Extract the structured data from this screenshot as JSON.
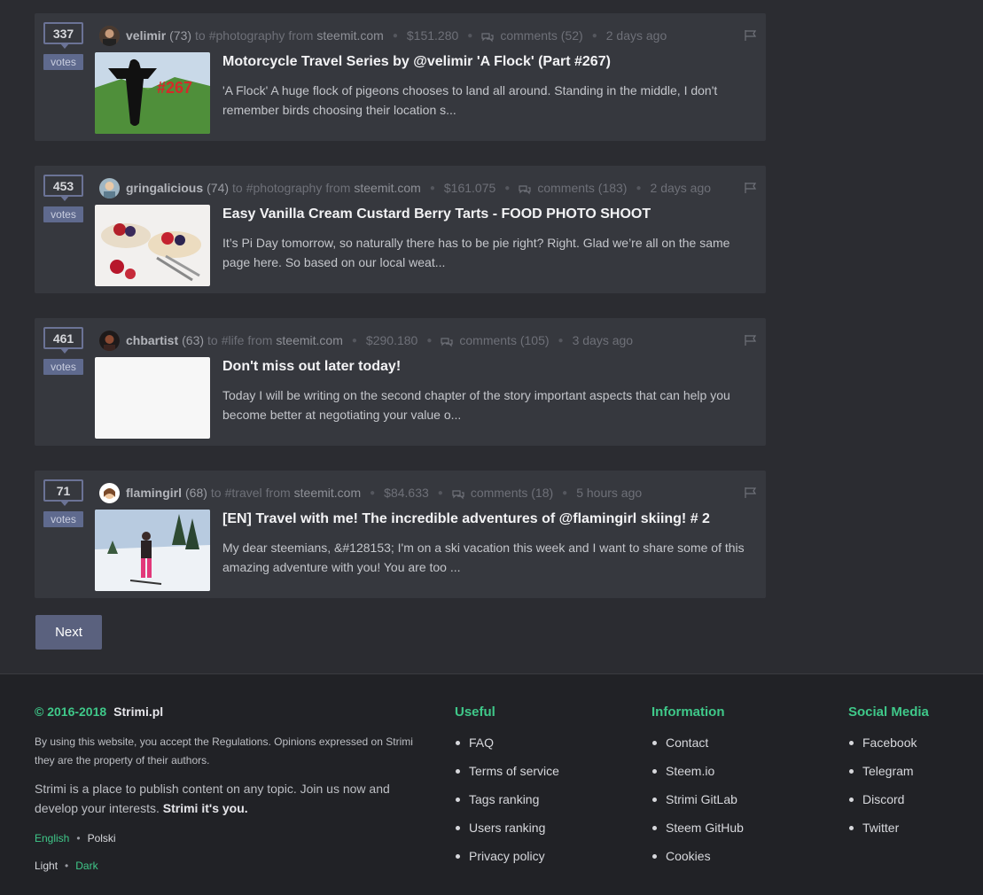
{
  "posts": [
    {
      "votes": "337",
      "votes_label": "votes",
      "author": "velimir",
      "rep": "(73)",
      "to": "to",
      "tag": "#photography",
      "from": "from",
      "site": "steemit.com",
      "payout": "$151.280",
      "comments": "comments (52)",
      "time": "2 days ago",
      "title": "Motorcycle Travel Series by @velimir 'A Flock' (Part #267)",
      "excerpt": "'A Flock' A huge flock of pigeons chooses to land all around. Standing in the middle, I don't remember birds choosing their location s...",
      "thumb_text": "#267"
    },
    {
      "votes": "453",
      "votes_label": "votes",
      "author": "gringalicious",
      "rep": "(74)",
      "to": "to",
      "tag": "#photography",
      "from": "from",
      "site": "steemit.com",
      "payout": "$161.075",
      "comments": "comments (183)",
      "time": "2 days ago",
      "title": "Easy Vanilla Cream Custard Berry Tarts - FOOD PHOTO SHOOT",
      "excerpt": "It’s Pi Day tomorrow, so naturally there has to be pie right? Right. Glad we’re all on the same page here. So based on our local weat..."
    },
    {
      "votes": "461",
      "votes_label": "votes",
      "author": "chbartist",
      "rep": "(63)",
      "to": "to",
      "tag": "#life",
      "from": "from",
      "site": "steemit.com",
      "payout": "$290.180",
      "comments": "comments (105)",
      "time": "3 days ago",
      "title": "Don't miss out later today!",
      "excerpt": "Today I will be writing on the second chapter of the story important aspects that can help you become better at negotiating your value o..."
    },
    {
      "votes": "71",
      "votes_label": "votes",
      "author": "flamingirl",
      "rep": "(68)",
      "to": "to",
      "tag": "#travel",
      "from": "from",
      "site": "steemit.com",
      "payout": "$84.633",
      "comments": "comments (18)",
      "time": "5 hours ago",
      "title": "[EN] Travel with me! The incredible adventures of @flamingirl skiing! # 2",
      "excerpt": "My dear steemians, &#128153; I'm on a ski vacation this week and I want to share some of this amazing adventure with you! You are too ..."
    }
  ],
  "pagination": {
    "next_label": "Next"
  },
  "footer": {
    "copyright": "© 2016-2018",
    "brand": "Strimi.pl",
    "regulations": "By using this website, you accept the Regulations. Opinions expressed on Strimi they are the property of their authors.",
    "about_text": "Strimi is a place to publish content on any topic. Join us now and develop your interests.",
    "about_bold": "Strimi it's you.",
    "lang_en": "English",
    "lang_pl": "Polski",
    "theme_light": "Light",
    "theme_dark": "Dark",
    "useful": {
      "heading": "Useful",
      "items": [
        "FAQ",
        "Terms of service",
        "Tags ranking",
        "Users ranking",
        "Privacy policy"
      ]
    },
    "information": {
      "heading": "Information",
      "items": [
        "Contact",
        "Steem.io",
        "Strimi GitLab",
        "Steem GitHub",
        "Cookies"
      ]
    },
    "social": {
      "heading": "Social Media",
      "items": [
        "Facebook",
        "Telegram",
        "Discord",
        "Twitter"
      ]
    }
  },
  "colors": {
    "accent_green": "#3fc889",
    "vote_blue": "#6b7396",
    "bg": "#2b2c31",
    "card": "#36383e",
    "footer": "#212226"
  },
  "icons": [
    "comment-icon",
    "flag-icon",
    "avatar"
  ]
}
